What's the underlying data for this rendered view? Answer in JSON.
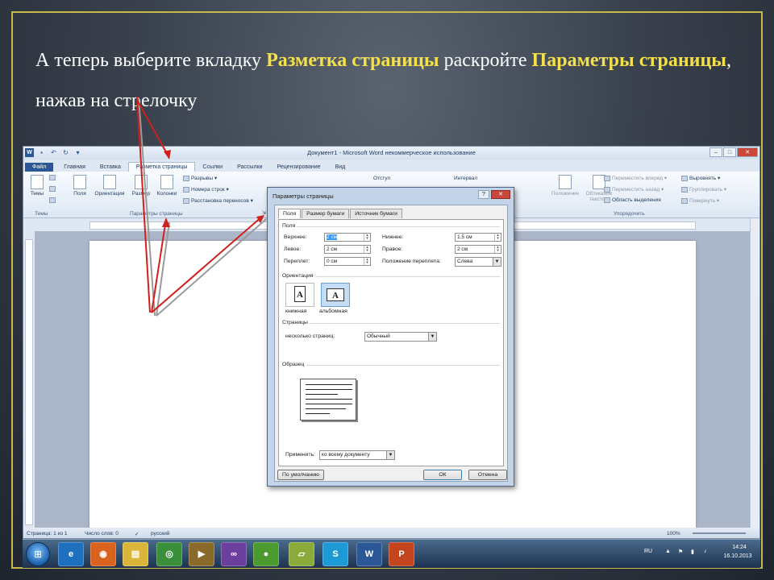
{
  "caption": {
    "t1": "А теперь выберите вкладку ",
    "b1": "Разметка страницы",
    "t2": " раскройте ",
    "b2": "Параметры страницы",
    "t3": ", нажав на стрелочку"
  },
  "colors": {
    "highlight": "#f4e04a",
    "frame": "#c9b84a",
    "arrow": "#d0201c"
  },
  "word": {
    "title": "Документ1 - Microsoft Word некоммерческое использование",
    "tabs": [
      "Файл",
      "Главная",
      "Вставка",
      "Разметка страницы",
      "Ссылки",
      "Рассылки",
      "Рецензирование",
      "Вид"
    ],
    "ribbon": {
      "themes_btn": "Темы",
      "themes_group": "Темы",
      "fields_btn": "Поля",
      "orientation_btn": "Ориентация",
      "size_btn": "Размер",
      "columns_btn": "Колонки",
      "breaks": "Разрывы",
      "line_numbers": "Номера строк",
      "hyphenation": "Расстановка переносов",
      "page_setup_group": "Параметры страницы",
      "indent": "Отступ",
      "spacing": "Интервал",
      "position_btn": "Положение",
      "wrap_btn": "Обтекание текстом",
      "bring_forward": "Переместить вперед",
      "send_backward": "Переместить назад",
      "selection_pane": "Область выделения",
      "align": "Выровнять",
      "group": "Группировать",
      "rotate": "Повернуть",
      "arrange_group": "Упорядочить"
    },
    "status": {
      "page": "Страница: 1 из 1",
      "words": "Число слов: 0",
      "lang": "русский",
      "zoom": "100%"
    }
  },
  "dialog": {
    "title": "Параметры страницы",
    "help": "?",
    "close": "✕",
    "tabs": [
      "Поля",
      "Размер бумаги",
      "Источник бумаги"
    ],
    "margins_section": "Поля",
    "top_label": "Верхнее:",
    "top_value": "2 см",
    "bottom_label": "Нижнее:",
    "bottom_value": "1,5 см",
    "left_label": "Левое:",
    "left_value": "2 см",
    "right_label": "Правое:",
    "right_value": "2 см",
    "gutter_label": "Переплет:",
    "gutter_value": "0 см",
    "gutter_pos_label": "Положение переплета:",
    "gutter_pos_value": "Слева",
    "orientation_section": "Ориентация",
    "portrait": "книжная",
    "landscape": "альбомная",
    "pages_section": "Страницы",
    "multiple_label": "несколько страниц:",
    "multiple_value": "Обычный",
    "preview_section": "Образец",
    "apply_label": "Применить:",
    "apply_value": "ко всему документу",
    "default_btn": "По умолчанию",
    "ok_btn": "ОК",
    "cancel_btn": "Отмена"
  },
  "taskbar": {
    "start_icon": "windows-start-icon",
    "apps": [
      "internet-explorer-icon",
      "firefox-icon",
      "explorer-icon",
      "chrome-icon",
      "media-player-icon",
      "visual-studio-icon",
      "green-app-icon",
      "folder-app-icon",
      "skype-icon",
      "word-icon",
      "powerpoint-icon"
    ],
    "lang": "RU",
    "time": "14:24",
    "date": "16.10.2013"
  }
}
